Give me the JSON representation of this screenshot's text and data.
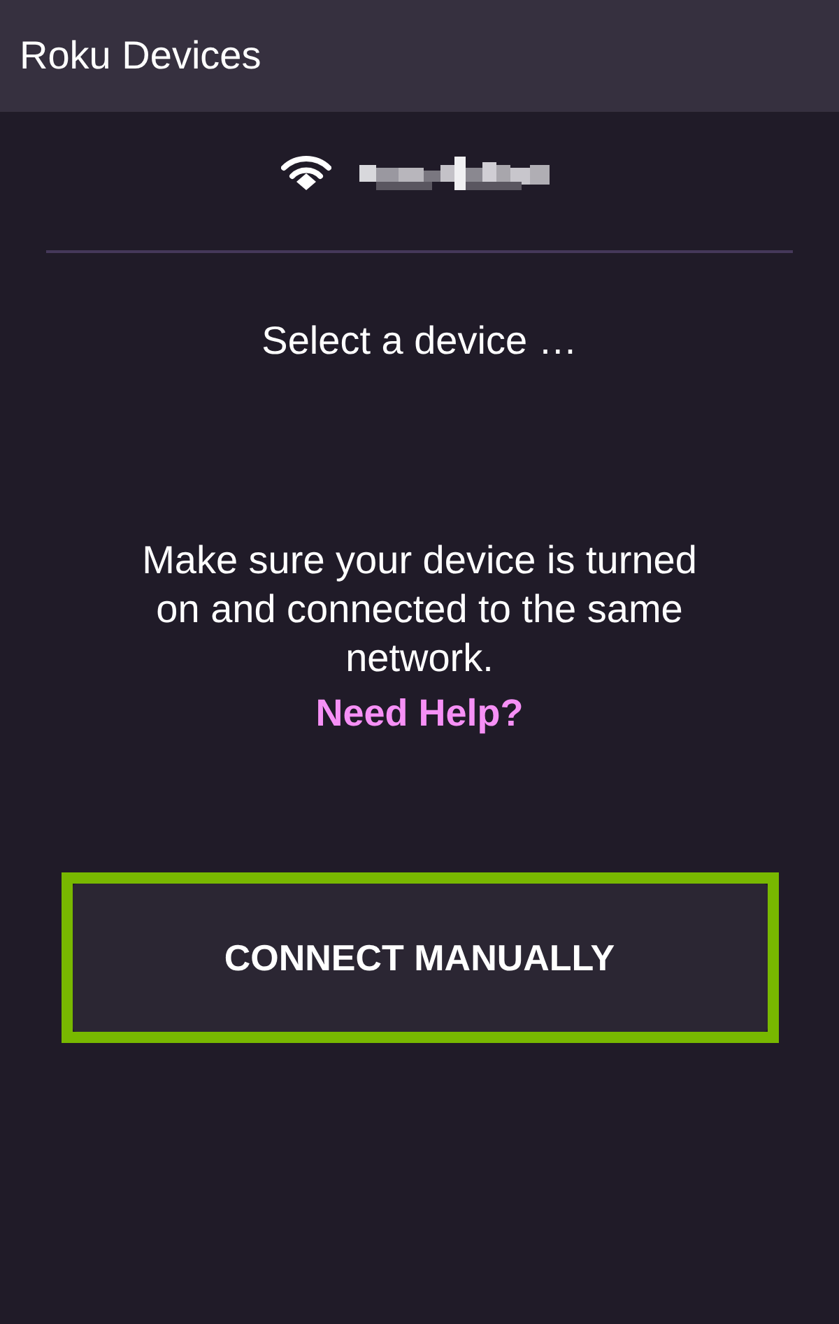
{
  "app_bar": {
    "title": "Roku Devices"
  },
  "prompt": "Select a device …",
  "message": "Make sure your device is turned on and connected to the same network.",
  "help_link": "Need Help?",
  "button": {
    "label": "CONNECT MANUALLY",
    "highlighted": true
  }
}
